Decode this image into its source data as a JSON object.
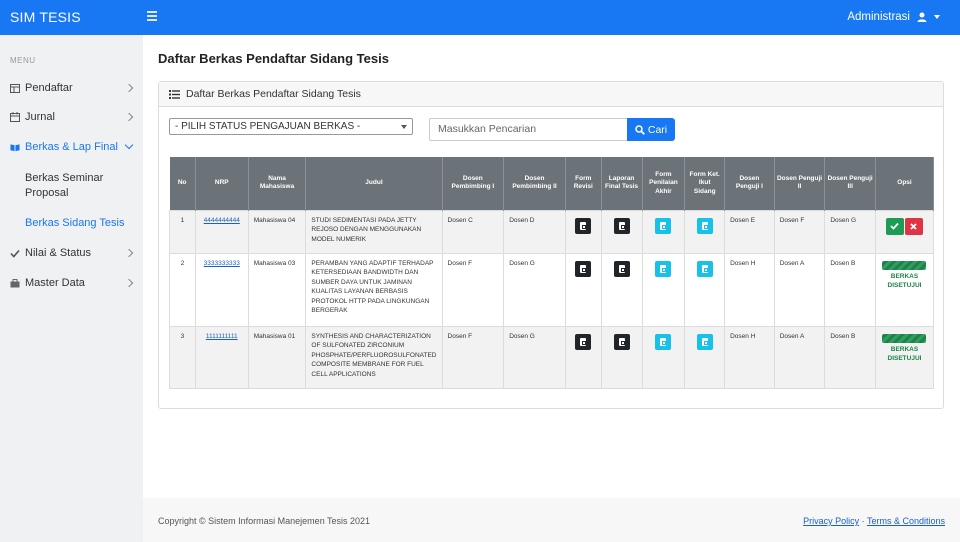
{
  "app": {
    "brand": "SIM TESIS",
    "user": "Administrasi"
  },
  "sidebar": {
    "menu_label": "MENU",
    "items": [
      {
        "label": "Pendaftar"
      },
      {
        "label": "Jurnal"
      },
      {
        "label": "Berkas & Lap Final"
      },
      {
        "label": "Nilai & Status"
      },
      {
        "label": "Master Data"
      }
    ],
    "sub_items": [
      {
        "label": "Berkas Seminar Proposal"
      },
      {
        "label": "Berkas Sidang Tesis"
      }
    ]
  },
  "page": {
    "title": "Daftar Berkas Pendaftar Sidang Tesis"
  },
  "card": {
    "title": "Daftar Berkas Pendaftar Sidang Tesis",
    "select_value": "- PILIH STATUS PENGAJUAN BERKAS -",
    "search_placeholder": "Masukkan Pencarian",
    "search_button": "Cari"
  },
  "table": {
    "headers": [
      "No",
      "NRP",
      "Nama Mahasiswa",
      "Judul",
      "Dosen Pembimbing I",
      "Dosen Pembimbing II",
      "Form Revisi",
      "Laporan Final Tesis",
      "Form Penilaian Akhir",
      "Form Ket. Ikut Sidang",
      "Dosen Penguji I",
      "Dosen Penguji II",
      "Dosen Penguji III",
      "Opsi"
    ],
    "rows": [
      {
        "no": "1",
        "nrp": "4444444444",
        "nama": "Mahasiswa 04",
        "judul": "STUDI SEDIMENTASI PADA JETTY REJOSO DENGAN MENGGUNAKAN MODEL NUMERIK",
        "pemb1": "Dosen C",
        "pemb2": "Dosen D",
        "peng1": "Dosen E",
        "peng2": "Dosen F",
        "peng3": "Dosen G",
        "status": ""
      },
      {
        "no": "2",
        "nrp": "3333333333",
        "nama": "Mahasiswa 03",
        "judul": "PERAMBAN YANG ADAPTIF TERHADAP KETERSEDIAAN BANDWIDTH DAN SUMBER DAYA UNTUK JAMINAN KUALITAS LAYANAN BERBASIS PROTOKOL HTTP PADA LINGKUNGAN BERGERAK",
        "pemb1": "Dosen F",
        "pemb2": "Dosen G",
        "peng1": "Dosen H",
        "peng2": "Dosen A",
        "peng3": "Dosen B",
        "status": "BERKAS DISETUJUI"
      },
      {
        "no": "3",
        "nrp": "1111111111",
        "nama": "Mahasiswa 01",
        "judul": "SYNTHESIS AND CHARACTERIZATION OF SULFONATED ZIRCONIUM PHOSPHATE/PERFLUOROSULFONATED COMPOSITE MEMBRANE FOR FUEL CELL APPLICATIONS",
        "pemb1": "Dosen F",
        "pemb2": "Dosen G",
        "peng1": "Dosen H",
        "peng2": "Dosen A",
        "peng3": "Dosen B",
        "status": "BERKAS DISETUJUI"
      }
    ]
  },
  "footer": {
    "copyright": "Copyright © Sistem Informasi Manejemen Tesis 2021",
    "privacy": "Privacy Policy",
    "separator": "·",
    "terms": "Terms & Conditions"
  },
  "colors": {
    "primary": "#1877f2",
    "header_gray": "#6b7379",
    "success": "#1e9b54",
    "danger": "#dc3545",
    "info": "#17c1e8",
    "dark": "#212529"
  },
  "icons": [
    "hamburger-icon",
    "user-icon",
    "table-icon",
    "calendar-icon",
    "book-icon",
    "check-icon",
    "briefcase-icon",
    "list-icon",
    "search-icon",
    "file-icon",
    "close-icon"
  ]
}
